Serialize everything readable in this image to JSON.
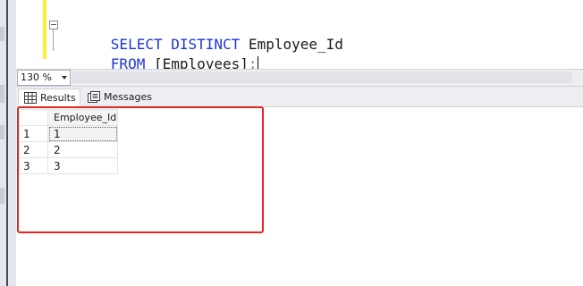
{
  "editor": {
    "line1": {
      "kw": "SELECT DISTINCT",
      "rest": " Employee_Id"
    },
    "line2": {
      "kw": "FROM",
      "rest": " [Employees]",
      "punct": ";"
    }
  },
  "zoom": {
    "value": "130 %"
  },
  "tabs": [
    {
      "label": "Results",
      "icon": "grid-icon"
    },
    {
      "label": "Messages",
      "icon": "messages-icon"
    }
  ],
  "results": {
    "columns": [
      "Employee_Id"
    ],
    "rows": [
      {
        "num": "1",
        "values": [
          "1"
        ]
      },
      {
        "num": "2",
        "values": [
          "2"
        ]
      },
      {
        "num": "3",
        "values": [
          "3"
        ]
      }
    ]
  },
  "colors": {
    "keyword": "#1b35d6",
    "highlight_border": "#e22525",
    "change_bar": "#ffee33"
  }
}
